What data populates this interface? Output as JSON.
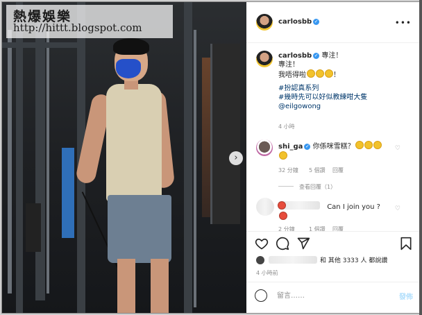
{
  "watermark": {
    "title": "熱爆娛樂",
    "url": "http://hittt.blogspot.com"
  },
  "post": {
    "author": "carlosbb",
    "caption_line1": "專注！",
    "caption_line2": "專注！",
    "caption_line3": "我唔得啦",
    "caption_line3_end": "！",
    "hashtag1": "#扮認真系列",
    "hashtag2": "#幾時先可以好似教練咁大隻",
    "mention": "@eilgowong",
    "time": "4 小時"
  },
  "comments": [
    {
      "user": "shi_ga",
      "text": "你係咪雪糕？",
      "likes": "32 分鐘",
      "like_count": "5 個讚",
      "reply": "回覆",
      "view_replies": "查看回覆（1）"
    },
    {
      "text": "Can I join you ?",
      "likes": "2 分鐘",
      "like_count": "1 個讚",
      "reply": "回覆"
    }
  ],
  "actions": {
    "liked_by": "和 其他 3333 人 都說讚",
    "time_ago": "4 小時前",
    "comment_placeholder": "留言……",
    "post_label": "發佈"
  },
  "colors": {
    "link": "#00376b",
    "verified": "#3897f0",
    "post_button": "#b2dffc"
  }
}
